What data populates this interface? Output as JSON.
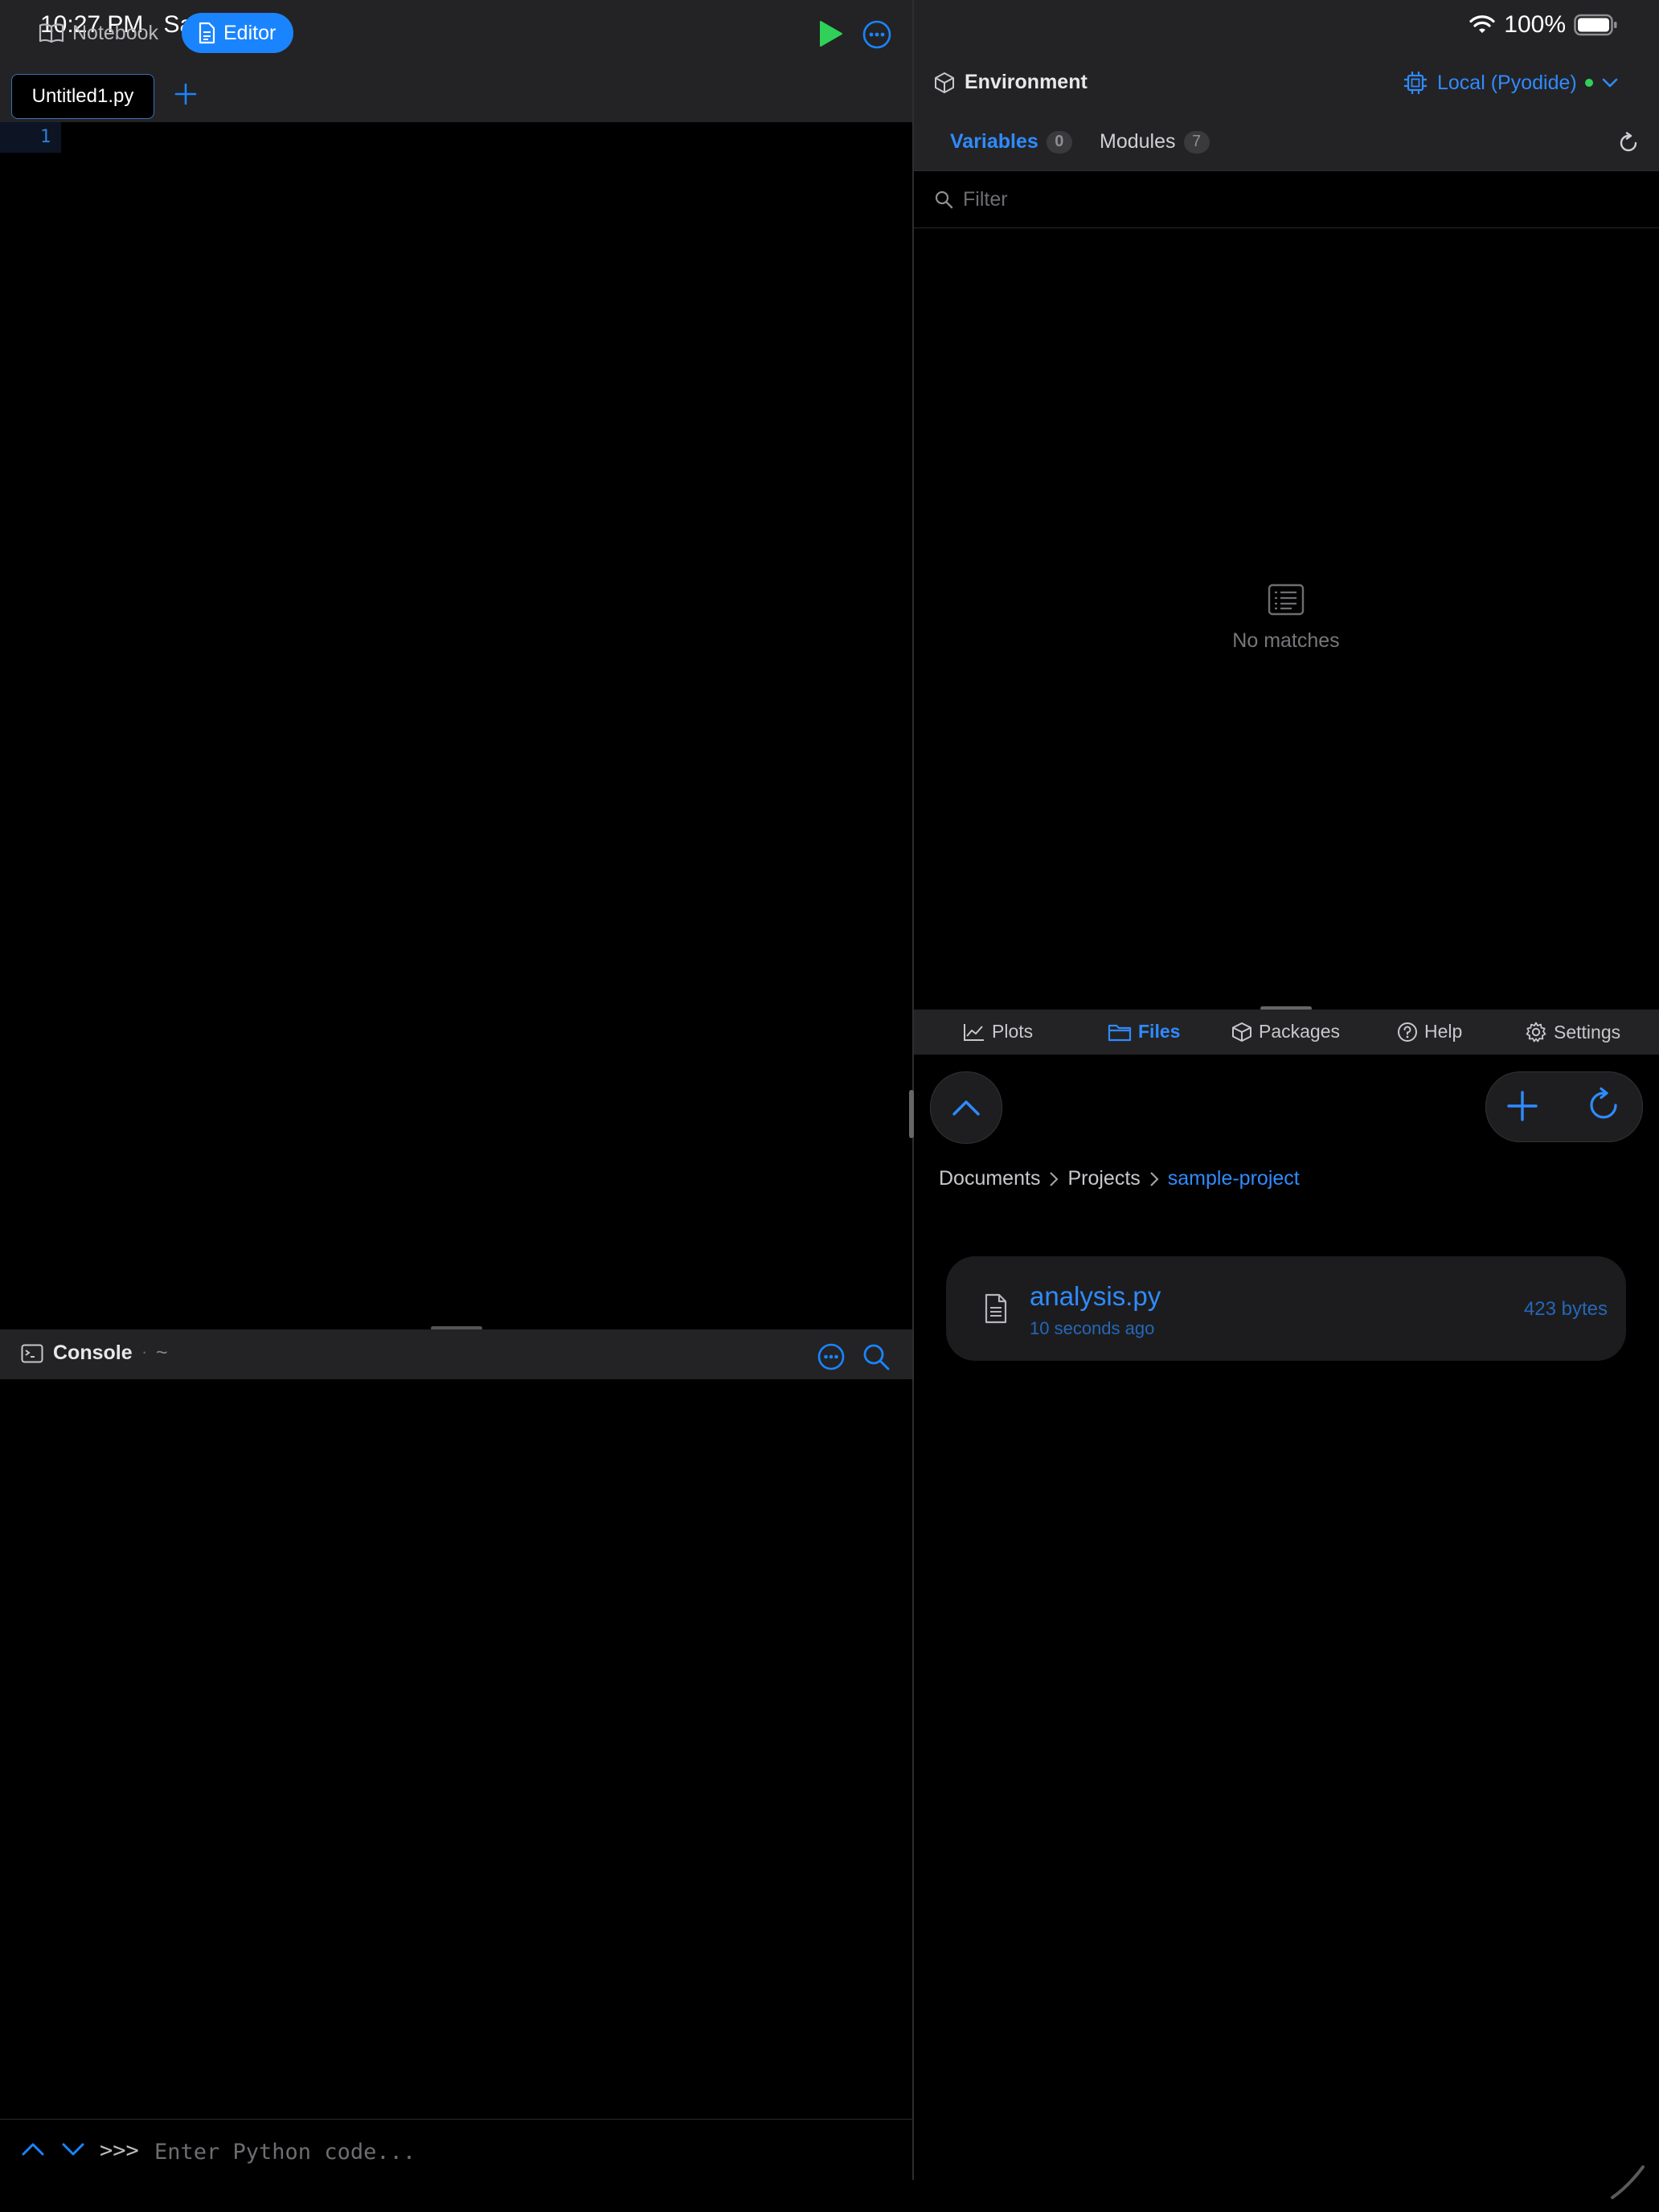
{
  "status_bar": {
    "time": "10:27 PM",
    "date": "Sat Apr 25",
    "battery": "100%"
  },
  "left_toolbar": {
    "mode_notebook": "Notebook",
    "mode_editor": "Editor",
    "accent": "#1a84ff",
    "run_color": "#2fd158"
  },
  "editor": {
    "tabs": [
      {
        "label": "Untitled1.py",
        "active": true
      }
    ],
    "line_numbers": [
      "1"
    ]
  },
  "console": {
    "title": "Console",
    "separator": "·",
    "cwd": "~",
    "prompt": ">>>",
    "input_placeholder": "Enter Python code..."
  },
  "environment": {
    "title": "Environment",
    "kernel": "Local (Pyodide)",
    "kernel_status_color": "#2fd158",
    "tabs": [
      {
        "label": "Variables",
        "count": "0",
        "active": true
      },
      {
        "label": "Modules",
        "count": "7",
        "active": false
      }
    ],
    "filter_placeholder": "Filter",
    "empty_message": "No matches"
  },
  "bottom_tabs": [
    {
      "label": "Plots",
      "icon": "chart-icon",
      "active": false
    },
    {
      "label": "Files",
      "icon": "folder-icon",
      "active": true
    },
    {
      "label": "Packages",
      "icon": "package-icon",
      "active": false
    },
    {
      "label": "Help",
      "icon": "help-icon",
      "active": false
    },
    {
      "label": "Settings",
      "icon": "gear-icon",
      "active": false
    }
  ],
  "files": {
    "breadcrumb": [
      "Documents",
      "Projects",
      "sample-project"
    ],
    "items": [
      {
        "name": "analysis.py",
        "modified": "10 seconds ago",
        "size": "423 bytes"
      }
    ]
  }
}
